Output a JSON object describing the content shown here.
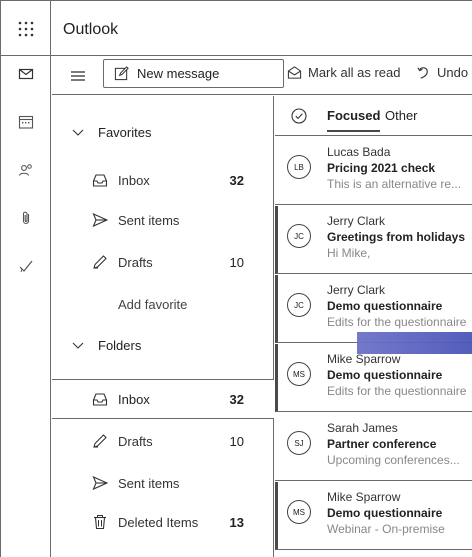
{
  "app": {
    "title": "Outlook"
  },
  "commands": {
    "new_message": "New message",
    "mark_all_read": "Mark all as read",
    "undo": "Undo"
  },
  "folders": {
    "favorites_header": "Favorites",
    "favorites": [
      {
        "label": "Inbox",
        "count": "32",
        "icon": "inbox-icon"
      },
      {
        "label": "Sent items",
        "count": "",
        "icon": "send-icon"
      },
      {
        "label": "Drafts",
        "count": "10",
        "icon": "pencil-icon"
      }
    ],
    "add_favorite": "Add favorite",
    "folders_header": "Folders",
    "items": [
      {
        "label": "Inbox",
        "count": "32",
        "icon": "inbox-icon"
      },
      {
        "label": "Drafts",
        "count": "10",
        "icon": "pencil-icon"
      },
      {
        "label": "Sent items",
        "count": "",
        "icon": "send-icon"
      },
      {
        "label": "Deleted Items",
        "count": "13",
        "icon": "trash-icon"
      }
    ]
  },
  "list": {
    "tabs": [
      "Focused",
      "Other"
    ],
    "active_tab": "Focused",
    "messages": [
      {
        "initials": "LB",
        "sender": "Lucas Bada",
        "subject": "Pricing 2021 check",
        "preview": "This is an alternative re...",
        "unread": false
      },
      {
        "initials": "JC",
        "sender": "Jerry Clark",
        "subject": "Greetings from holidays",
        "preview": "Hi Mike,",
        "unread": true
      },
      {
        "initials": "JC",
        "sender": "Jerry Clark",
        "subject": "Demo questionnaire",
        "preview": "Edits for the questionnaire",
        "unread": true
      },
      {
        "initials": "MS",
        "sender": "Mike Sparrow",
        "subject": "Demo questionnaire",
        "preview": "Edits for the questionnaire",
        "unread": true
      },
      {
        "initials": "SJ",
        "sender": "Sarah James",
        "subject": "Partner conference",
        "preview": "Upcoming conferences...",
        "unread": false
      },
      {
        "initials": "MS",
        "sender": "Mike Sparrow",
        "subject": "Demo questionnaire",
        "preview": "Webinar - On-premise",
        "unread": true
      }
    ]
  },
  "colors": {
    "accent_drag": "#5560bd",
    "border": "#6b6b6b"
  }
}
